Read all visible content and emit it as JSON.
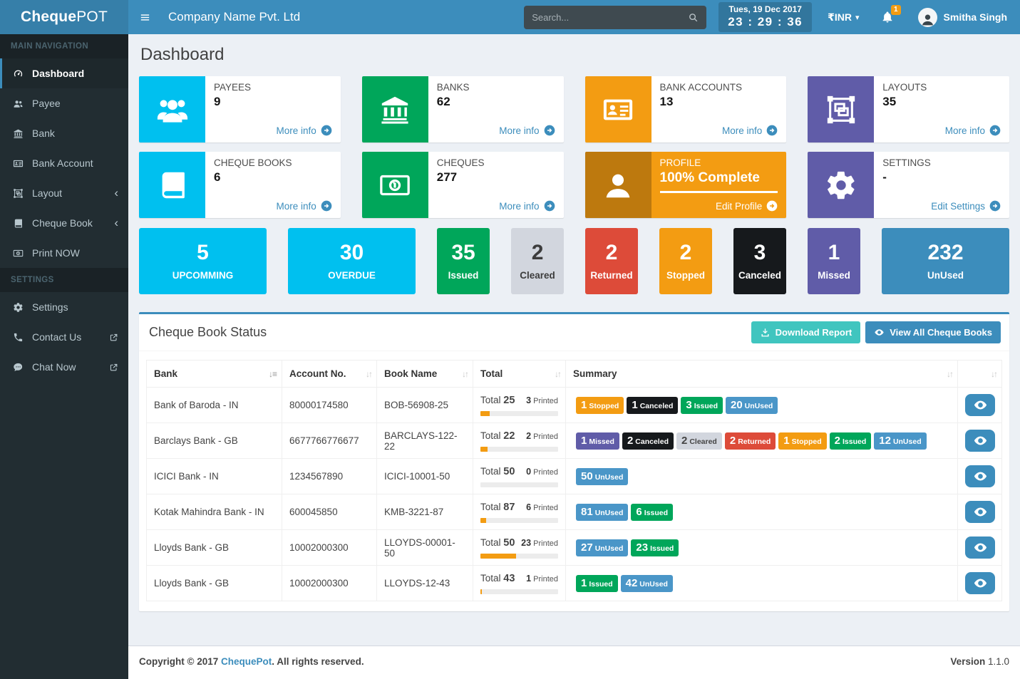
{
  "brand": {
    "bold": "Cheque",
    "light": "POT"
  },
  "header": {
    "company_name": "Company Name Pvt. Ltd",
    "search_placeholder": "Search...",
    "date": "Tues, 19 Dec 2017",
    "time": "23 : 29 : 36",
    "currency_symbol": "₹",
    "currency": "INR",
    "notification_count": "1",
    "user_name": "Smitha Singh"
  },
  "sidebar": {
    "sections": [
      {
        "label": "MAIN NAVIGATION"
      },
      {
        "label": "SETTINGS"
      }
    ],
    "items": [
      {
        "label": "Dashboard",
        "icon": "dashboard-icon",
        "active": true
      },
      {
        "label": "Payee",
        "icon": "users-icon"
      },
      {
        "label": "Bank",
        "icon": "bank-icon"
      },
      {
        "label": "Bank Account",
        "icon": "id-card-icon"
      },
      {
        "label": "Layout",
        "icon": "object-group-icon",
        "chevron": true
      },
      {
        "label": "Cheque Book",
        "icon": "book-icon",
        "chevron": true
      },
      {
        "label": "Print NOW",
        "icon": "money-icon"
      },
      {
        "label": "Settings",
        "icon": "gear-icon"
      },
      {
        "label": "Contact Us",
        "icon": "phone-icon",
        "external": true
      },
      {
        "label": "Chat Now",
        "icon": "chat-icon",
        "external": true
      }
    ]
  },
  "page_title": "Dashboard",
  "info_boxes": [
    {
      "label": "PAYEES",
      "value": "9",
      "link": "More info",
      "color": "#00c0ef",
      "icon": "users-icon"
    },
    {
      "label": "BANKS",
      "value": "62",
      "link": "More info",
      "color": "#00a65a",
      "icon": "bank-icon"
    },
    {
      "label": "BANK ACCOUNTS",
      "value": "13",
      "link": "More info",
      "color": "#f39c12",
      "icon": "id-card-icon"
    },
    {
      "label": "LAYOUTS",
      "value": "35",
      "link": "More info",
      "color": "#605ca8",
      "icon": "object-group-icon"
    },
    {
      "label": "CHEQUE BOOKS",
      "value": "6",
      "link": "More info",
      "color": "#00c0ef",
      "icon": "book-icon"
    },
    {
      "label": "CHEQUES",
      "value": "277",
      "link": "More info",
      "color": "#00a65a",
      "icon": "money-icon"
    },
    {
      "label": "PROFILE",
      "value": "100% Complete",
      "link": "Edit Profile",
      "color": "#f39c12",
      "icon": "user-icon",
      "progress_pct": 100
    },
    {
      "label": "SETTINGS",
      "value": "-",
      "link": "Edit Settings",
      "color": "#605ca8",
      "icon": "gear-icon"
    }
  ],
  "tiles": [
    {
      "value": "5",
      "label": "UPCOMMING",
      "color": "#00c0ef"
    },
    {
      "value": "30",
      "label": "OVERDUE",
      "color": "#00c0ef"
    },
    {
      "value": "35",
      "label": "Issued",
      "color": "#00a65a"
    },
    {
      "value": "2",
      "label": "Cleared",
      "color": "#d2d6de"
    },
    {
      "value": "2",
      "label": "Returned",
      "color": "#dd4b39"
    },
    {
      "value": "2",
      "label": "Stopped",
      "color": "#f39c12"
    },
    {
      "value": "3",
      "label": "Canceled",
      "color": "#16191c"
    },
    {
      "value": "1",
      "label": "Missed",
      "color": "#605ca8"
    },
    {
      "value": "232",
      "label": "UnUsed",
      "color": "#3c8dbc"
    }
  ],
  "status_colors": {
    "Stopped": "#f39c12",
    "Canceled": "#16191c",
    "Issued": "#00a65a",
    "UnUsed": "#4a96c8",
    "Missed": "#605ca8",
    "Cleared": "#d2d6de",
    "Returned": "#dd4b39"
  },
  "panel": {
    "title": "Cheque Book Status",
    "buttons": {
      "download": "Download Report",
      "view_all": "View All Cheque Books"
    },
    "columns": {
      "bank": "Bank",
      "account": "Account No.",
      "book": "Book Name",
      "total": "Total",
      "summary": "Summary"
    },
    "labels": {
      "total": "Total",
      "printed": "Printed"
    },
    "rows": [
      {
        "bank": "Bank of Baroda - IN",
        "account": "80000174580",
        "book": "BOB-56908-25",
        "total": "25",
        "printed": "3",
        "printed_pct": 12,
        "badges": [
          {
            "count": "1",
            "status": "Stopped"
          },
          {
            "count": "1",
            "status": "Canceled"
          },
          {
            "count": "3",
            "status": "Issued"
          },
          {
            "count": "20",
            "status": "UnUsed"
          }
        ]
      },
      {
        "bank": "Barclays Bank - GB",
        "account": "6677766776677",
        "book": "BARCLAYS-122-22",
        "total": "22",
        "printed": "2",
        "printed_pct": 9,
        "badges": [
          {
            "count": "1",
            "status": "Missed"
          },
          {
            "count": "2",
            "status": "Canceled"
          },
          {
            "count": "2",
            "status": "Cleared"
          },
          {
            "count": "2",
            "status": "Returned"
          },
          {
            "count": "1",
            "status": "Stopped"
          },
          {
            "count": "2",
            "status": "Issued"
          },
          {
            "count": "12",
            "status": "UnUsed"
          }
        ]
      },
      {
        "bank": "ICICI Bank - IN",
        "account": "1234567890",
        "book": "ICICI-10001-50",
        "total": "50",
        "printed": "0",
        "printed_pct": 0,
        "badges": [
          {
            "count": "50",
            "status": "UnUsed"
          }
        ]
      },
      {
        "bank": "Kotak Mahindra Bank - IN",
        "account": "600045850",
        "book": "KMB-3221-87",
        "total": "87",
        "printed": "6",
        "printed_pct": 7,
        "badges": [
          {
            "count": "81",
            "status": "UnUsed"
          },
          {
            "count": "6",
            "status": "Issued"
          }
        ]
      },
      {
        "bank": "Lloyds Bank - GB",
        "account": "10002000300",
        "book": "LLOYDS-00001-50",
        "total": "50",
        "printed": "23",
        "printed_pct": 46,
        "badges": [
          {
            "count": "27",
            "status": "UnUsed"
          },
          {
            "count": "23",
            "status": "Issued"
          }
        ]
      },
      {
        "bank": "Lloyds Bank - GB",
        "account": "10002000300",
        "book": "LLOYDS-12-43",
        "total": "43",
        "printed": "1",
        "printed_pct": 2,
        "badges": [
          {
            "count": "1",
            "status": "Issued"
          },
          {
            "count": "42",
            "status": "UnUsed"
          }
        ]
      }
    ]
  },
  "footer": {
    "left_bold": "Copyright © 2017",
    "brand": "ChequePot",
    "left_rest": ". All rights reserved.",
    "version_label": "Version",
    "version": "1.1.0"
  },
  "colors": {
    "header": "#3c8dbc",
    "logo_bg": "#367fa9",
    "sidebar": "#222d32",
    "content_bg": "#ecf0f5",
    "accent": "#3c8dbc",
    "teal_button": "#40c5bf",
    "progress_fill": "#f39c12"
  }
}
